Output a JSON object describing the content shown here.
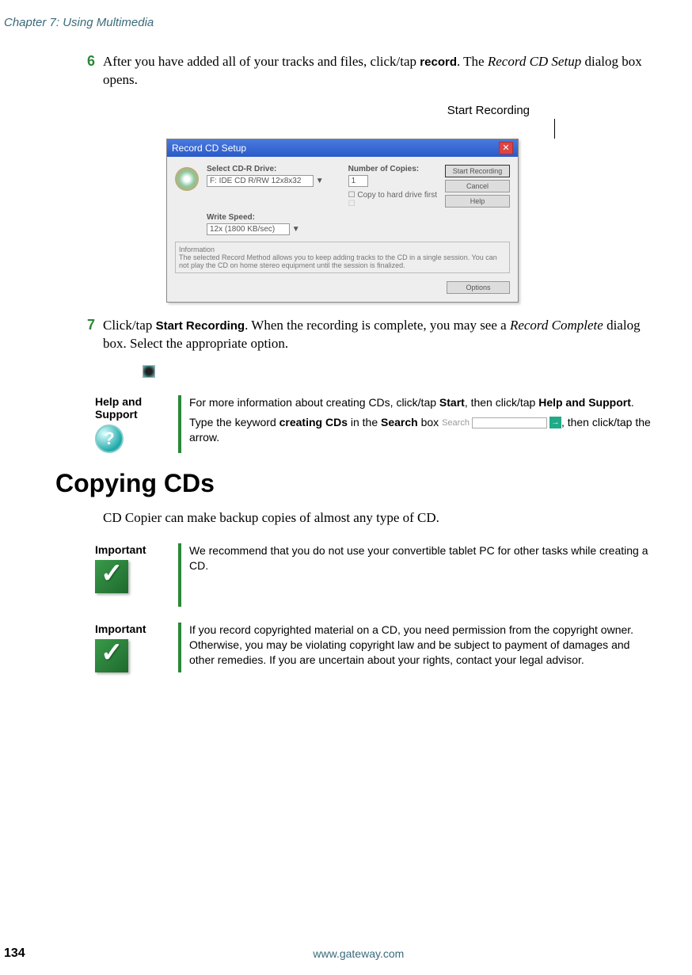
{
  "chapter_header": "Chapter 7: Using Multimedia",
  "step6": {
    "num": "6",
    "text_pre": "After you have added all of your tracks and files, click/tap ",
    "bold1": "record",
    "text_mid1": ". The ",
    "italic1": "Record CD Setup",
    "text_post": " dialog box opens."
  },
  "callout": "Start Recording",
  "dialog": {
    "title": "Record CD Setup",
    "label_drive": "Select CD-R Drive:",
    "value_drive": "F: IDE CD R/RW 12x8x32",
    "label_copies": "Number of Copies:",
    "value_copies": "1",
    "chk1": "Copy to hard drive first",
    "chk2": "",
    "label_speed": "Write Speed:",
    "value_speed": "12x (1800 KB/sec)",
    "btn_start": "Start Recording",
    "btn_cancel": "Cancel",
    "btn_help": "Help",
    "btn_options": "Options",
    "info_label": "Information",
    "info_text": "The selected Record Method allows you to keep adding tracks to the CD in a single session. You can not play the CD on home stereo equipment until the session is finalized."
  },
  "step7": {
    "num": "7",
    "text_pre": "Click/tap ",
    "bold1": "Start Recording",
    "text_mid1": ". When the recording is complete, you may see a ",
    "italic1": "Record Complete",
    "text_post": " dialog box. Select the appropriate option."
  },
  "help": {
    "label": "Help and Support",
    "line1_pre": "For more information about creating CDs, click/tap ",
    "line1_b1": "Start",
    "line1_mid": ", then click/tap ",
    "line1_b2": "Help and Support",
    "line1_post": ".",
    "line2_pre": "Type the keyword ",
    "line2_b1": "creating CDs",
    "line2_mid": " in the ",
    "line2_b2": "Search",
    "line2_post1": " box ",
    "search_label": "Search",
    "line2_post2": ", then click/tap the arrow."
  },
  "section_heading": "Copying CDs",
  "section_intro": "CD Copier can make backup copies of almost any type of CD.",
  "important1": {
    "label": "Important",
    "text": "We recommend that you do not use your convertible tablet PC for other tasks while creating a CD."
  },
  "important2": {
    "label": "Important",
    "text": "If you record copyrighted material on a CD, you need permission from the copyright owner. Otherwise, you may be violating copyright law and be subject to payment of damages and other remedies. If you are uncertain about your rights, contact your legal advisor."
  },
  "footer": {
    "page": "134",
    "url": "www.gateway.com"
  }
}
